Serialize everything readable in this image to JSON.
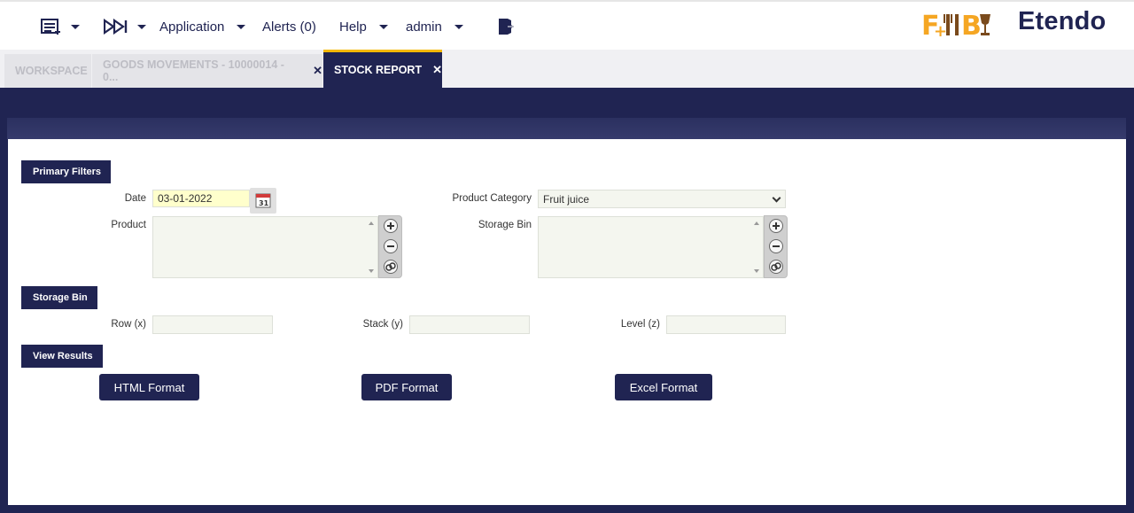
{
  "topbar": {
    "menu_icon": "workspace-menu-icon",
    "quick_launch_icon": "quick-launch-icon",
    "application_label": "Application",
    "alerts_label": "Alerts (0)",
    "help_label": "Help",
    "user_label": "admin",
    "logout_icon": "logout-icon",
    "logo_fb_text": "F+IB",
    "logo_etendo": "Etendo"
  },
  "tabs": [
    {
      "label": "WORKSPACE"
    },
    {
      "label": "GOODS MOVEMENTS - 10000014 - 0...",
      "close": "✕"
    },
    {
      "label": "STOCK REPORT",
      "close": "✕"
    }
  ],
  "primary_filters": {
    "title": "Primary Filters",
    "date_label": "Date",
    "date_value": "03-01-2022",
    "product_label": "Product",
    "product_category_label": "Product Category",
    "product_category_value": "Fruit juice",
    "storage_bin_label": "Storage Bin"
  },
  "storage_bin": {
    "title": "Storage Bin",
    "row_label": "Row (x)",
    "stack_label": "Stack (y)",
    "level_label": "Level (z)"
  },
  "view_results": {
    "title": "View Results",
    "html_label": "HTML Format",
    "pdf_label": "PDF Format",
    "excel_label": "Excel Format"
  },
  "colors": {
    "brand_navy": "#202452",
    "tab_highlight": "#f5b800",
    "logo_orange": "#f5a623",
    "logo_brown": "#7a4a1c"
  }
}
